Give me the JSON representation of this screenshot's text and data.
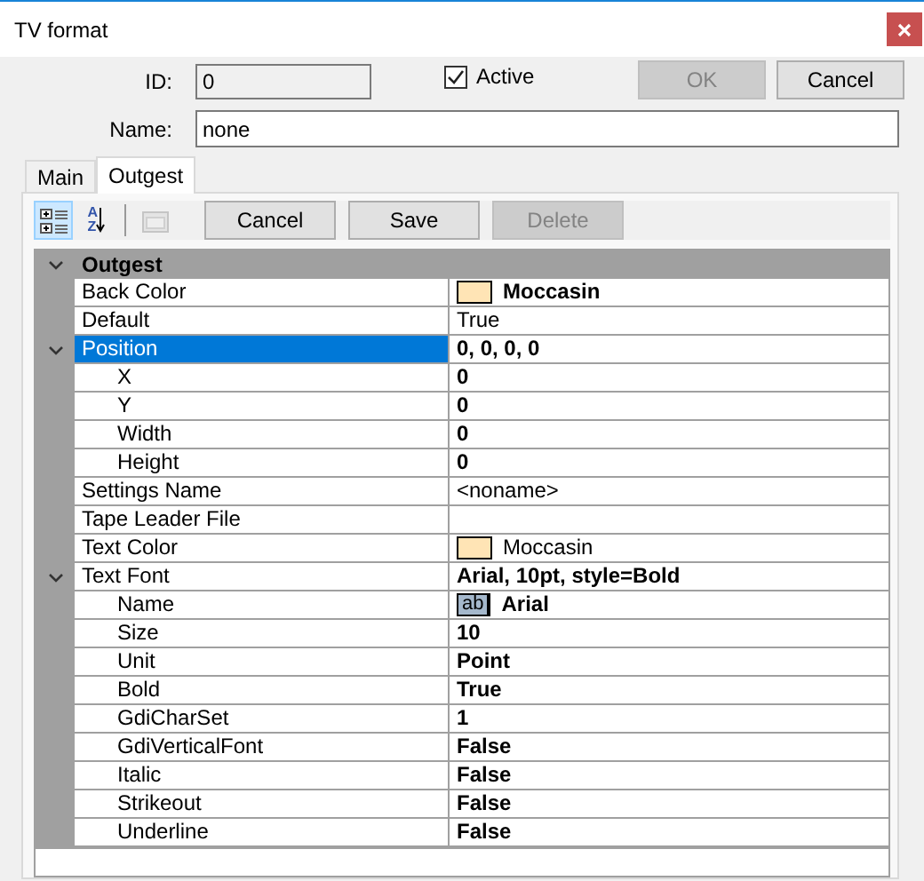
{
  "window": {
    "title": "TV format"
  },
  "form": {
    "id": {
      "label": "ID:",
      "value": "0"
    },
    "active": {
      "label": "Active",
      "checked": true
    },
    "name": {
      "label": "Name:",
      "value": "none"
    }
  },
  "buttons": [
    {
      "label": "OK",
      "disabled": true
    },
    {
      "label": "Cancel",
      "disabled": false
    }
  ],
  "tabs": [
    {
      "label": "Main",
      "selected": false
    },
    {
      "label": "Outgest",
      "selected": true
    }
  ],
  "tools": [
    {
      "kind": "categorized",
      "selected": true,
      "disabled": false
    },
    {
      "kind": "alphabetical",
      "label": "AZ",
      "selected": false,
      "disabled": false
    },
    {
      "kind": "pages",
      "selected": false,
      "disabled": true
    }
  ],
  "panel_buttons": [
    {
      "label": "Cancel",
      "disabled": false
    },
    {
      "label": "Save",
      "disabled": false
    },
    {
      "label": "Delete",
      "disabled": true
    }
  ],
  "grid": {
    "category": {
      "label": "Outgest",
      "expanded": true
    },
    "rows": [
      {
        "name": "Back Color",
        "kind": "color",
        "value": "Moccasin",
        "color": "#ffe4b5",
        "modified": true,
        "selected": false
      },
      {
        "name": "Default",
        "kind": "text",
        "value": "True",
        "modified": false,
        "selected": false
      },
      {
        "name": "Position",
        "kind": "text",
        "value": "0, 0, 0, 0",
        "modified": true,
        "selected": true,
        "expanded": true,
        "children": [
          {
            "name": "X",
            "kind": "text",
            "value": "0",
            "modified": true,
            "selected": false
          },
          {
            "name": "Y",
            "kind": "text",
            "value": "0",
            "modified": true,
            "selected": false
          },
          {
            "name": "Width",
            "kind": "text",
            "value": "0",
            "modified": true,
            "selected": false
          },
          {
            "name": "Height",
            "kind": "text",
            "value": "0",
            "modified": true,
            "selected": false
          }
        ]
      },
      {
        "name": "Settings Name",
        "kind": "text",
        "value": "<noname>",
        "modified": false,
        "selected": false
      },
      {
        "name": "Tape Leader File",
        "kind": "text",
        "selected": false
      },
      {
        "name": "Text Color",
        "kind": "color",
        "value": "Moccasin",
        "color": "#ffe4b5",
        "modified": false,
        "selected": false
      },
      {
        "name": "Text Font",
        "kind": "text",
        "value": "Arial, 10pt, style=Bold",
        "modified": true,
        "selected": false,
        "expanded": true,
        "children": [
          {
            "name": "Name",
            "kind": "font",
            "sample": "ab",
            "value": "Arial",
            "modified": true,
            "selected": false
          },
          {
            "name": "Size",
            "kind": "text",
            "value": "10",
            "modified": true,
            "selected": false
          },
          {
            "name": "Unit",
            "kind": "text",
            "value": "Point",
            "modified": true,
            "selected": false
          },
          {
            "name": "Bold",
            "kind": "text",
            "value": "True",
            "modified": true,
            "selected": false
          },
          {
            "name": "GdiCharSet",
            "kind": "text",
            "value": "1",
            "modified": true,
            "selected": false
          },
          {
            "name": "GdiVerticalFont",
            "kind": "text",
            "value": "False",
            "modified": true,
            "selected": false
          },
          {
            "name": "Italic",
            "kind": "text",
            "value": "False",
            "modified": true,
            "selected": false
          },
          {
            "name": "Strikeout",
            "kind": "text",
            "value": "False",
            "modified": true,
            "selected": false
          },
          {
            "name": "Underline",
            "kind": "text",
            "value": "False",
            "modified": true,
            "selected": false
          }
        ]
      }
    ]
  }
}
